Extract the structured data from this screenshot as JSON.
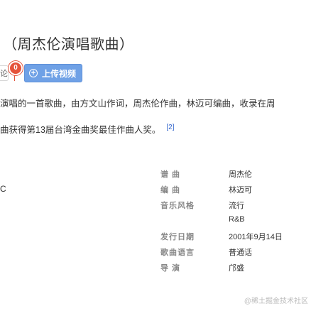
{
  "song": {
    "title": "（周杰伦演唱歌曲）"
  },
  "edit": {
    "input_fragment": "论",
    "badge_count": "0",
    "upload_label": "上传视频"
  },
  "summary": "演唱的一首歌曲，由方文山作词，周杰伦作曲，林迈可编曲，收录在周",
  "award": {
    "text": "曲获得第13届台湾金曲奖最佳作曲人奖。",
    "ref": "[2]"
  },
  "info_rows": [
    {
      "left": "",
      "name": "谱 曲",
      "value": "周杰伦"
    },
    {
      "left": "C",
      "name": "编 曲",
      "value": "林迈可"
    },
    {
      "left": "",
      "name": "音乐风格",
      "value": "流行"
    },
    {
      "left": "",
      "name": "",
      "value": "R&B"
    },
    {
      "left": "",
      "name": "发行日期",
      "value": "2001年9月14日"
    },
    {
      "left": "",
      "name": "歌曲语言",
      "value": "普通话"
    },
    {
      "left": "",
      "name": "导 演",
      "value": "邝盛"
    }
  ],
  "watermark": "@稀土掘金技术社区",
  "colors": {
    "accent_button": "#6fa1e6",
    "badge": "#e5533b",
    "link": "#3366cc"
  },
  "icons": {
    "upload": "plus-circle-icon"
  }
}
